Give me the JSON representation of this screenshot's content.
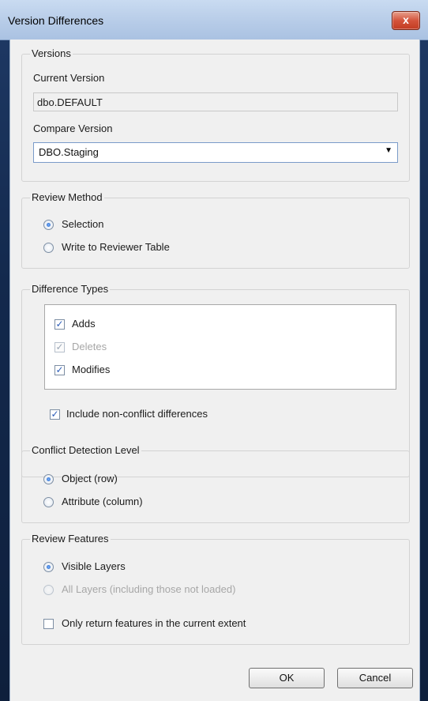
{
  "window": {
    "title": "Version Differences",
    "close_label": "x"
  },
  "versions": {
    "group_label": "Versions",
    "current_label": "Current Version",
    "current_value": "dbo.DEFAULT",
    "compare_label": "Compare Version",
    "compare_value": "DBO.Staging"
  },
  "review_method": {
    "group_label": "Review Method",
    "options": [
      {
        "label": "Selection",
        "checked": true
      },
      {
        "label": "Write to Reviewer Table",
        "checked": false
      }
    ]
  },
  "difference_types": {
    "group_label": "Difference Types",
    "items": [
      {
        "label": "Adds",
        "checked": true,
        "enabled": true
      },
      {
        "label": "Deletes",
        "checked": true,
        "enabled": false
      },
      {
        "label": "Modifies",
        "checked": true,
        "enabled": true
      }
    ],
    "include_nonconflict_label": "Include non-conflict differences",
    "include_nonconflict_checked": true
  },
  "conflict_detection": {
    "group_label": "Conflict Detection Level",
    "options": [
      {
        "label": "Object (row)",
        "checked": true
      },
      {
        "label": "Attribute (column)",
        "checked": false
      }
    ]
  },
  "review_features": {
    "group_label": "Review Features",
    "options": [
      {
        "label": "Visible Layers",
        "checked": true,
        "enabled": true
      },
      {
        "label": "All Layers (including those not loaded)",
        "checked": false,
        "enabled": false
      }
    ],
    "extent_label": "Only return features in the current extent",
    "extent_checked": false
  },
  "buttons": {
    "ok": "OK",
    "cancel": "Cancel"
  }
}
